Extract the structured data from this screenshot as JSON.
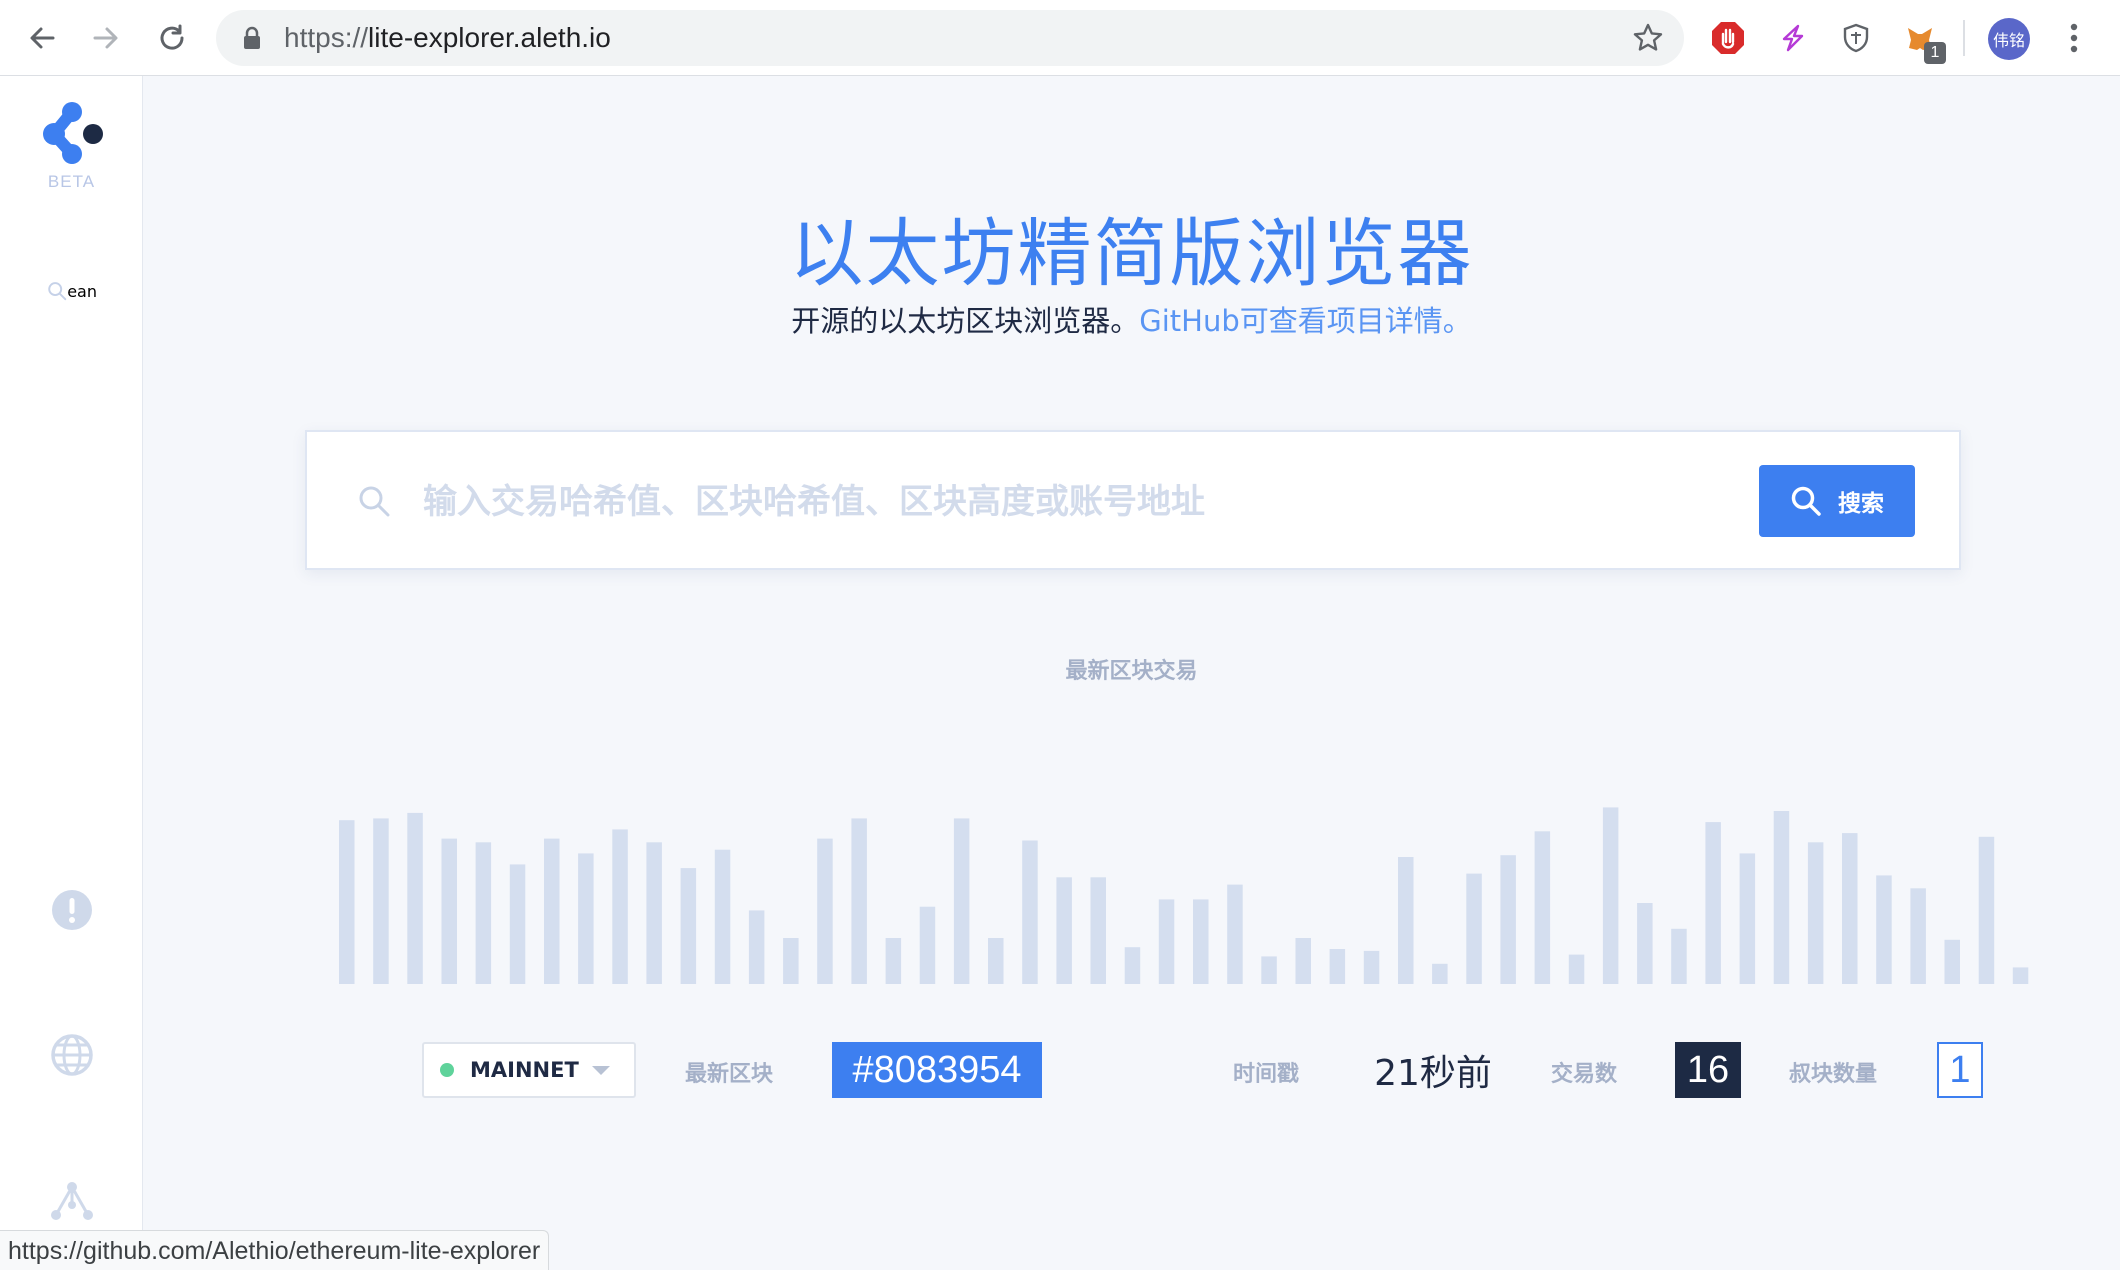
{
  "browser": {
    "url_scheme": "https://",
    "url_host": "lite-explorer.aleth.io",
    "profile_initials": "伟铭",
    "extension_badge": "1",
    "status_url": "https://github.com/Alethio/ethereum-lite-explorer"
  },
  "sidebar": {
    "beta_label": "BETA",
    "icons": [
      "logo-icon",
      "search-icon",
      "alert-icon",
      "globe-icon",
      "network-icon"
    ]
  },
  "header": {
    "title": "以太坊精简版浏览器",
    "subtitle": "开源的以太坊区块浏览器。",
    "github_link": "GitHub可查看项目详情。"
  },
  "search": {
    "placeholder": "输入交易哈希值、区块哈希值、区块高度或账号地址",
    "button_label": "搜索"
  },
  "chart_data": {
    "type": "bar",
    "title": "最新区块交易",
    "values": [
      89,
      90,
      93,
      79,
      77,
      65,
      79,
      71,
      84,
      77,
      63,
      73,
      40,
      25,
      79,
      90,
      25,
      42,
      90,
      25,
      78,
      58,
      58,
      20,
      46,
      46,
      54,
      15,
      25,
      19,
      18,
      69,
      11,
      60,
      70,
      83,
      16,
      96,
      44,
      30,
      88,
      71,
      94,
      77,
      82,
      59,
      52,
      24,
      80,
      9
    ],
    "color": "#d4deef"
  },
  "stats": {
    "network": "MAINNET",
    "network_color": "#5fd39b",
    "latest_block_label": "最新区块",
    "latest_block_value": "#8083954",
    "timestamp_label": "时间戳",
    "timestamp_value": "21秒前",
    "tx_count_label": "交易数",
    "tx_count_value": "16",
    "uncle_count_label": "叔块数量",
    "uncle_count_value": "1"
  }
}
